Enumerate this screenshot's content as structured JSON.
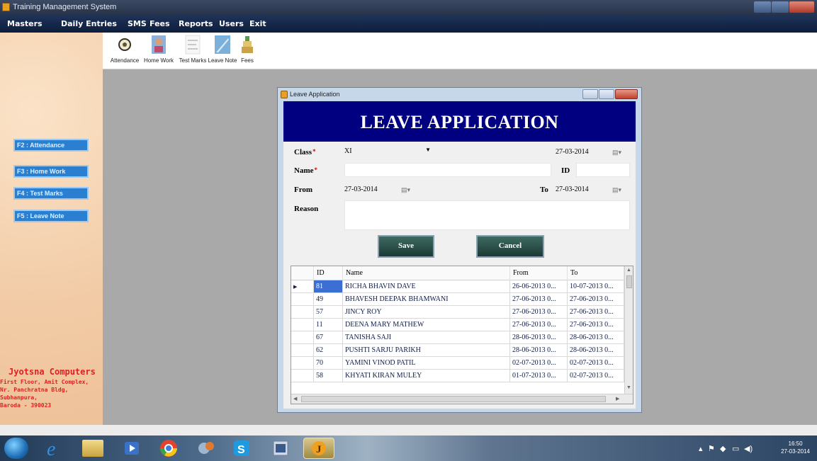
{
  "window": {
    "title": "Training Management System"
  },
  "menu": [
    "Masters",
    "Daily Entries",
    "SMS",
    "Fees",
    "Reports",
    "Users",
    "Exit"
  ],
  "toolbar": [
    {
      "label": "Attendance",
      "icon": "attendance-icon"
    },
    {
      "label": "Home Work",
      "icon": "homework-icon"
    },
    {
      "label": "Test Marks",
      "icon": "test-marks-icon"
    },
    {
      "label": "Leave Note",
      "icon": "leave-note-icon"
    },
    {
      "label": "Fees",
      "icon": "fees-icon"
    }
  ],
  "shortcuts": [
    "F2 : Attendance",
    "F3 : Home Work",
    "F4 : Test Marks",
    "F5 : Leave Note"
  ],
  "company": {
    "name": "Jyotsna Computers",
    "address": [
      "First Floor, Amit Complex,",
      "Nr. Panchratna Bldg,",
      "Subhanpura,",
      "Baroda - 390023"
    ]
  },
  "dialog": {
    "title": "Leave Application",
    "banner": "LEAVE APPLICATION",
    "labels": {
      "class": "Class",
      "name": "Name",
      "id": "ID",
      "from": "From",
      "to": "To",
      "reason": "Reason"
    },
    "required_mark": "*",
    "class_value": "XI",
    "date_value": "27-03-2014",
    "name_value": "",
    "id_value": "",
    "from_value": "27-03-2014",
    "to_value": "27-03-2014",
    "reason_value": "",
    "save_label": "Save",
    "cancel_label": "Cancel",
    "grid": {
      "columns": [
        "ID",
        "Name",
        "From",
        "To"
      ],
      "rows": [
        {
          "id": "81",
          "name": "RICHA  BHAVIN DAVE",
          "from": "26-06-2013 0...",
          "to": "10-07-2013 0..."
        },
        {
          "id": "49",
          "name": "BHAVESH DEEPAK BHAMWANI",
          "from": "27-06-2013 0...",
          "to": "27-06-2013 0..."
        },
        {
          "id": "57",
          "name": "JINCY ROY",
          "from": "27-06-2013 0...",
          "to": "27-06-2013 0..."
        },
        {
          "id": "11",
          "name": "DEENA MARY MATHEW",
          "from": "27-06-2013 0...",
          "to": "27-06-2013 0..."
        },
        {
          "id": "67",
          "name": "TANISHA SAJI",
          "from": "28-06-2013 0...",
          "to": "28-06-2013 0..."
        },
        {
          "id": "62",
          "name": "PUSHTI SARJU PARIKH",
          "from": "28-06-2013 0...",
          "to": "28-06-2013 0..."
        },
        {
          "id": "70",
          "name": "YAMINI VINOD PATIL",
          "from": "02-07-2013 0...",
          "to": "02-07-2013 0..."
        },
        {
          "id": "58",
          "name": "KHYATI KIRAN MULEY",
          "from": "01-07-2013 0...",
          "to": "02-07-2013 0..."
        }
      ]
    }
  },
  "taskbar": {
    "time": "16:50",
    "date": "27-03-2014"
  },
  "colors": {
    "banner": "#000080",
    "menubar": "#13254a",
    "required": "#e00000",
    "shortcut": "#2a7fd0"
  }
}
